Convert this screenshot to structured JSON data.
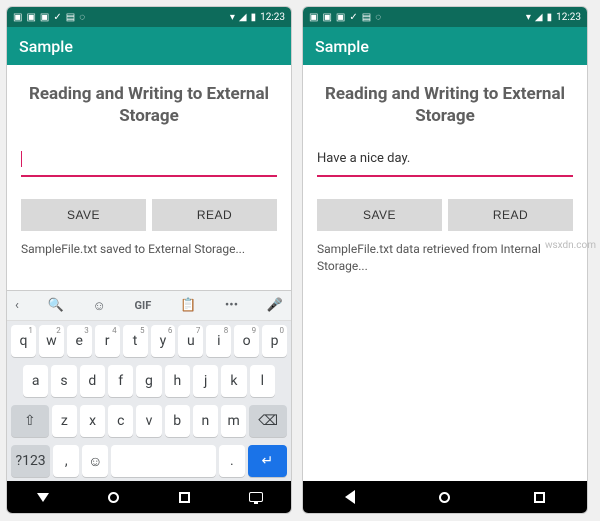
{
  "status": {
    "time": "12:23"
  },
  "appbar": {
    "title": "Sample"
  },
  "heading": "Reading and Writing to External Storage",
  "left": {
    "input_value": "",
    "msg": "SampleFile.txt saved to External Storage..."
  },
  "right": {
    "input_value": "Have a nice day.",
    "msg": "SampleFile.txt data retrieved from Internal Storage..."
  },
  "buttons": {
    "save": "SAVE",
    "read": "READ"
  },
  "keyboard": {
    "toprow": {
      "chevron": "‹",
      "search": "🔍",
      "sticker": "☺",
      "gif": "GIF",
      "clip": "📋",
      "more": "•••",
      "mic": "🎤"
    },
    "row1": [
      "q",
      "w",
      "e",
      "r",
      "t",
      "y",
      "u",
      "i",
      "o",
      "p"
    ],
    "row1_hints": [
      "1",
      "2",
      "3",
      "4",
      "5",
      "6",
      "7",
      "8",
      "9",
      "0"
    ],
    "row2": [
      "a",
      "s",
      "d",
      "f",
      "g",
      "h",
      "j",
      "k",
      "l"
    ],
    "row3": [
      "z",
      "x",
      "c",
      "v",
      "b",
      "n",
      "m"
    ],
    "shift": "⇧",
    "backspace": "⌫",
    "sym": "?123",
    "comma": ",",
    "emoji": "☺",
    "period": ".",
    "enter": "↵"
  },
  "watermark": "wsxdn.com"
}
